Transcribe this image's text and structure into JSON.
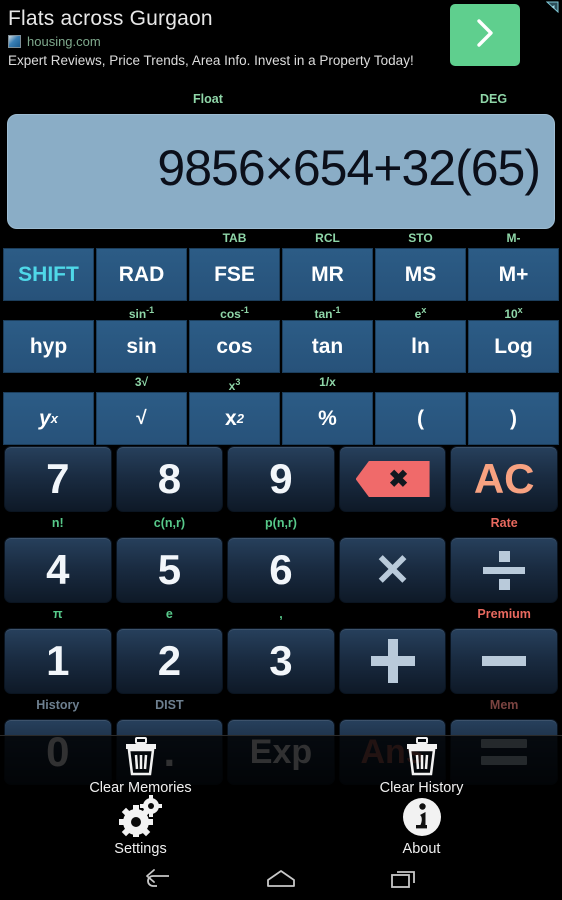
{
  "ad": {
    "title": "Flats across Gurgaon",
    "domain": "housing.com",
    "description": "Expert Reviews, Price Trends, Area Info. Invest in a Property Today!",
    "cta_icon": "chevron-right-icon",
    "info_icon": "ad-info-icon",
    "cta_color": "#5fcf8e"
  },
  "modes": {
    "notation": "Float",
    "angle": "DEG"
  },
  "display": {
    "expression": "9856×654+32(65)",
    "background": "#8aadc6",
    "text_color": "#0b0f1a"
  },
  "keypad": {
    "function_rows": [
      {
        "supers": [
          "",
          "",
          "TAB",
          "RCL",
          "STO",
          "M-"
        ],
        "keys": [
          {
            "label": "SHIFT",
            "style": "shift"
          },
          {
            "label": "RAD",
            "style": "normal"
          },
          {
            "label": "FSE",
            "style": "normal"
          },
          {
            "label": "MR",
            "style": "normal"
          },
          {
            "label": "MS",
            "style": "normal"
          },
          {
            "label": "M+",
            "style": "normal"
          }
        ]
      },
      {
        "supers": [
          "",
          "sin-1",
          "cos-1",
          "tan-1",
          "e^x",
          "10^x"
        ],
        "keys": [
          {
            "label": "hyp",
            "style": "normal"
          },
          {
            "label": "sin",
            "style": "normal"
          },
          {
            "label": "cos",
            "style": "normal"
          },
          {
            "label": "tan",
            "style": "normal"
          },
          {
            "label": "ln",
            "style": "normal"
          },
          {
            "label": "Log",
            "style": "normal"
          }
        ]
      },
      {
        "supers": [
          "",
          "3√",
          "x^3",
          "1/x",
          "",
          ""
        ],
        "keys": [
          {
            "label": "y^x",
            "style": "normal"
          },
          {
            "label": "√",
            "style": "normal"
          },
          {
            "label": "x^2",
            "style": "normal"
          },
          {
            "label": "%",
            "style": "normal"
          },
          {
            "label": "(",
            "style": "normal"
          },
          {
            "label": ")",
            "style": "normal"
          }
        ]
      }
    ],
    "superscript_text": {
      "tab": "TAB",
      "rcl": "RCL",
      "sto": "STO",
      "mminus": "M-",
      "sin_inv": "sin",
      "cos_inv": "cos",
      "tan_inv": "tan",
      "inv_exp": "-1",
      "e_base": "e",
      "e_exp": "x",
      "ten_base": "10",
      "ten_exp": "x",
      "cbrt": "3√",
      "x3_base": "x",
      "x3_exp": "3",
      "one_over_x": "1/x"
    },
    "labels": {
      "shift": "SHIFT",
      "rad": "RAD",
      "fse": "FSE",
      "mr": "MR",
      "ms": "MS",
      "mplus": "M+",
      "hyp": "hyp",
      "sin": "sin",
      "cos": "cos",
      "tan": "tan",
      "ln": "ln",
      "log": "Log",
      "y_base": "y",
      "y_exp": "x",
      "sqrt": "√",
      "x2_base": "x",
      "x2_exp": "2",
      "percent": "%",
      "lparen": "(",
      "rparen": ")",
      "seven": "7",
      "eight": "8",
      "nine": "9",
      "four": "4",
      "five": "5",
      "six": "6",
      "one": "1",
      "two": "2",
      "three": "3",
      "zero": "0",
      "dot": ".",
      "exp": "Exp",
      "ans": "Ans",
      "ac": "AC"
    },
    "sublabels": {
      "n_factorial": "n!",
      "combination": "c(n,r)",
      "permutation": "p(n,r)",
      "rate": "Rate",
      "pi": "π",
      "e_const": "e",
      "comma": ",",
      "premium": "Premium",
      "history": "History",
      "dist": "DIST",
      "mem": "Mem"
    },
    "icons": {
      "backspace": "backspace-icon",
      "multiply": "multiply-icon",
      "divide": "divide-icon",
      "plus": "plus-icon",
      "minus": "minus-icon",
      "equals": "equals-icon"
    },
    "colors": {
      "function_key": "#2c5c86",
      "shift_text": "#4fd8e8",
      "numeric_key": "#1a2c42",
      "superscript_green": "#8fd6a8",
      "accent_salmon": "#f7a281",
      "backspace_red": "#f06a6a"
    }
  },
  "menu": {
    "items": [
      {
        "label": "Clear Memories",
        "icon": "trash-icon"
      },
      {
        "label": "Clear History",
        "icon": "trash-icon"
      },
      {
        "label": "Settings",
        "icon": "gears-icon"
      },
      {
        "label": "About",
        "icon": "info-circle-icon"
      }
    ]
  },
  "navbar": {
    "back": "back-icon",
    "home": "home-icon",
    "recents": "recent-apps-icon"
  }
}
